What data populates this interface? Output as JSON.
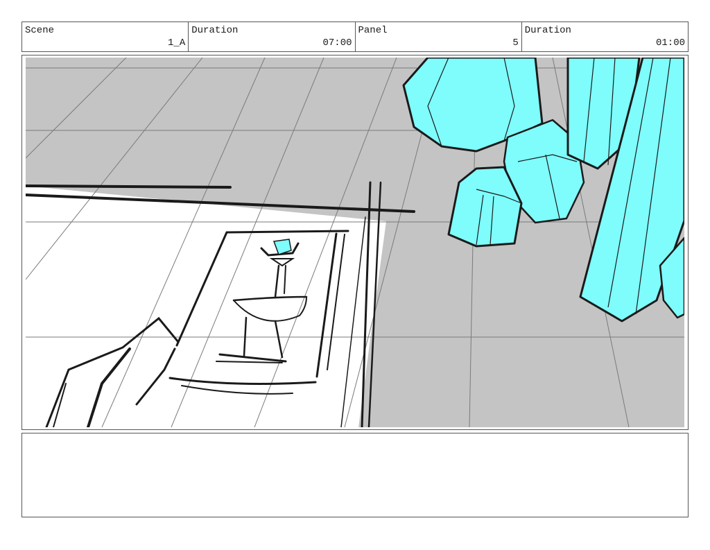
{
  "header": {
    "scene_label": "Scene",
    "scene_value": "1_A",
    "duration_label": "Duration",
    "duration_value": "07:00",
    "panel_label": "Panel",
    "panel_value": "5",
    "panel_duration_label": "Duration",
    "panel_duration_value": "01:00"
  },
  "colors": {
    "floor_gray": "#c4c4c4",
    "crystal_cyan": "#7ffcfc",
    "ink": "#1a1a1a"
  },
  "notes": {
    "text": ""
  }
}
